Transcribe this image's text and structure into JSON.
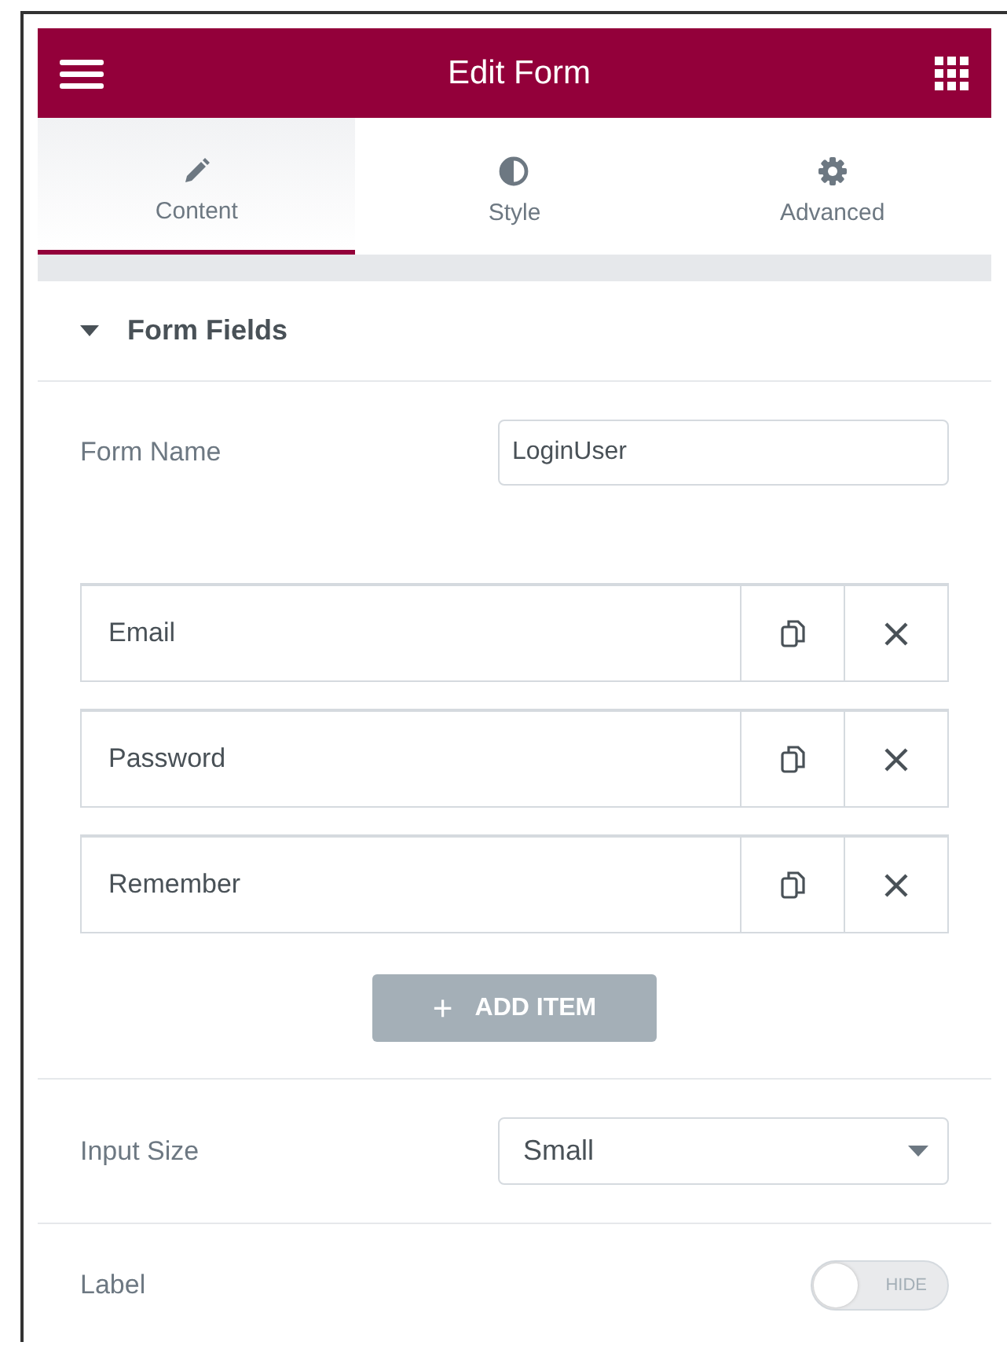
{
  "header": {
    "title": "Edit Form"
  },
  "tabs": [
    {
      "label": "Content",
      "kind": "pencil",
      "selected": true
    },
    {
      "label": "Style",
      "kind": "contrast",
      "selected": false
    },
    {
      "label": "Advanced",
      "kind": "gear",
      "selected": false
    }
  ],
  "section": {
    "title": "Form Fields",
    "expanded": true
  },
  "form_name": {
    "label": "Form Name",
    "value": "LoginUser"
  },
  "fields": [
    {
      "label": "Email"
    },
    {
      "label": "Password"
    },
    {
      "label": "Remember"
    }
  ],
  "add_button": {
    "icon": "+",
    "label": "ADD ITEM"
  },
  "input_size": {
    "label": "Input Size",
    "value": "Small"
  },
  "label_toggle": {
    "label": "Label",
    "text": "HIDE",
    "on": false
  }
}
